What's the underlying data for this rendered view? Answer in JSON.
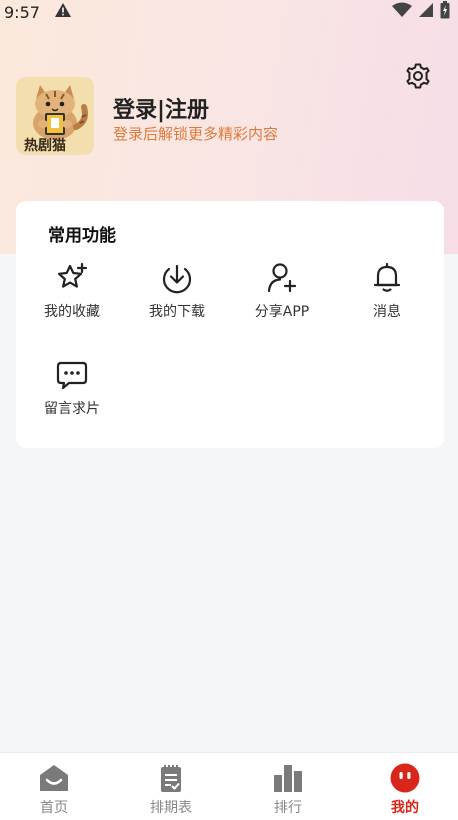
{
  "status": {
    "time": "9:57"
  },
  "header": {
    "avatar_text": "热剧猫",
    "login_title": "登录|注册",
    "login_subtitle": "登录后解锁更多精彩内容"
  },
  "functions": {
    "title": "常用功能",
    "items": [
      {
        "label": "我的收藏",
        "icon": "star-plus-icon"
      },
      {
        "label": "我的下载",
        "icon": "download-icon"
      },
      {
        "label": "分享APP",
        "icon": "add-user-icon"
      },
      {
        "label": "消息",
        "icon": "bell-icon"
      },
      {
        "label": "留言求片",
        "icon": "message-icon"
      }
    ]
  },
  "tabbar": {
    "items": [
      {
        "label": "首页",
        "icon": "home-icon"
      },
      {
        "label": "排期表",
        "icon": "schedule-icon"
      },
      {
        "label": "排行",
        "icon": "ranking-icon"
      },
      {
        "label": "我的",
        "icon": "profile-icon",
        "active": true
      }
    ]
  },
  "colors": {
    "accent": "#d8261c",
    "subtitle": "#e07a3a"
  }
}
